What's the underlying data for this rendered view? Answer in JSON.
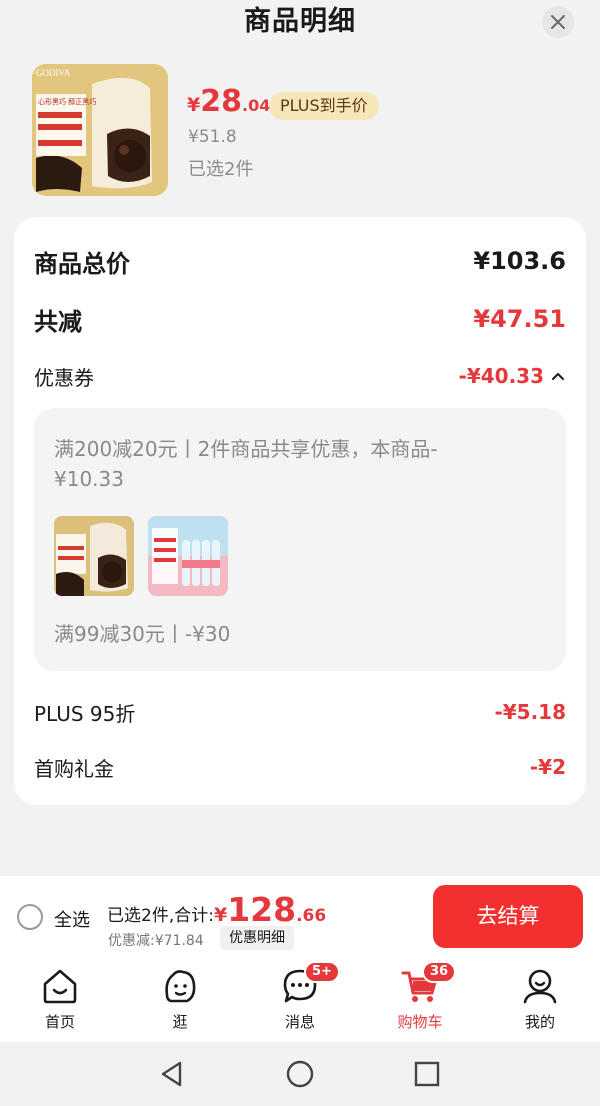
{
  "header": {
    "title": "商品明细"
  },
  "product": {
    "price_yen": "¥",
    "price_int": "28",
    "price_dec": ".04",
    "plus_tag": "PLUS到手价",
    "original_price": "¥51.8",
    "selected_count": "已选2件",
    "image_brand": "GODIVA",
    "image_caption": "心形黑巧 醇正黑巧"
  },
  "summary": {
    "total_label": "商品总价",
    "total_value": "¥103.6",
    "reduce_label": "共减",
    "reduce_value": "¥47.51",
    "coupon_label": "优惠券",
    "coupon_value": "-¥40.33",
    "coupon_detail_1": "满200减20元丨2件商品共享优惠，本商品-¥10.33",
    "coupon_detail_2": "满99减30元丨-¥30",
    "plus_label": "PLUS 95折",
    "plus_value": "-¥5.18",
    "first_label": "首购礼金",
    "first_value": "-¥2"
  },
  "bottom_bar": {
    "select_all": "全选",
    "selected_total_label": "已选2件,合计:",
    "total_yen": "¥",
    "total_int": "128",
    "total_dec": ".66",
    "discount": "优惠减:¥71.84",
    "detail_button": "优惠明细",
    "checkout": "去结算"
  },
  "tabbar": {
    "items": [
      {
        "label": "首页",
        "icon": "home-icon"
      },
      {
        "label": "逛",
        "icon": "browse-icon"
      },
      {
        "label": "消息",
        "icon": "message-icon",
        "badge": "5+"
      },
      {
        "label": "购物车",
        "icon": "cart-icon",
        "badge": "36",
        "active": true
      },
      {
        "label": "我的",
        "icon": "profile-icon"
      }
    ]
  },
  "colors": {
    "accent": "#e4393c",
    "plus_gold": "#f7e6b7",
    "checkout": "#f23030"
  }
}
